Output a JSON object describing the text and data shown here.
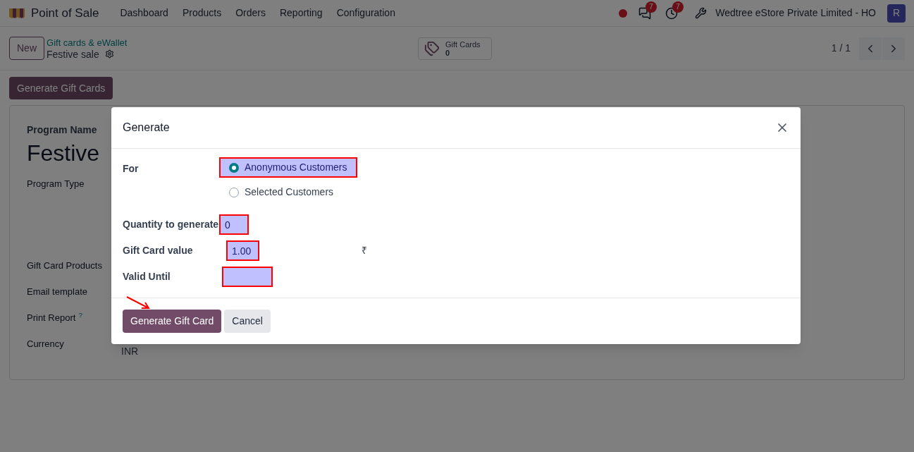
{
  "navbar": {
    "app_name": "Point of Sale",
    "menu": [
      "Dashboard",
      "Products",
      "Orders",
      "Reporting",
      "Configuration"
    ],
    "messages_count": "7",
    "activities_count": "7",
    "company": "Wedtree eStore Private Limited - HO",
    "avatar": "R"
  },
  "control_panel": {
    "new_button": "New",
    "breadcrumb": "Gift cards & eWallet",
    "record": "Festive sale",
    "smart_button": {
      "label": "Gift Cards",
      "count": "0"
    },
    "pager": "1 / 1"
  },
  "action_button": "Generate Gift Cards",
  "form": {
    "title_label": "Program Name",
    "title_value": "Festive",
    "fields": [
      {
        "label": "Program Type"
      },
      {
        "label": "Gift Card Products"
      },
      {
        "label": "Email template"
      },
      {
        "label": "Print Report",
        "help": "?"
      },
      {
        "label": "Currency",
        "value": "INR"
      }
    ]
  },
  "dialog": {
    "title": "Generate",
    "for_label": "For",
    "options": [
      {
        "label": "Anonymous Customers",
        "selected": true,
        "highlighted": true
      },
      {
        "label": "Selected Customers",
        "selected": false,
        "highlighted": false
      }
    ],
    "fields": [
      {
        "label": "Quantity to generate",
        "value": "0",
        "highlighted": true
      },
      {
        "label": "Gift Card value",
        "value": "1.00",
        "suffix": "₹",
        "highlighted": true
      },
      {
        "label": "Valid Until",
        "highlighted": true
      }
    ],
    "buttons": [
      {
        "label": "Generate Gift Card",
        "kind": "primary"
      },
      {
        "label": "Cancel",
        "kind": "secondary"
      }
    ]
  }
}
